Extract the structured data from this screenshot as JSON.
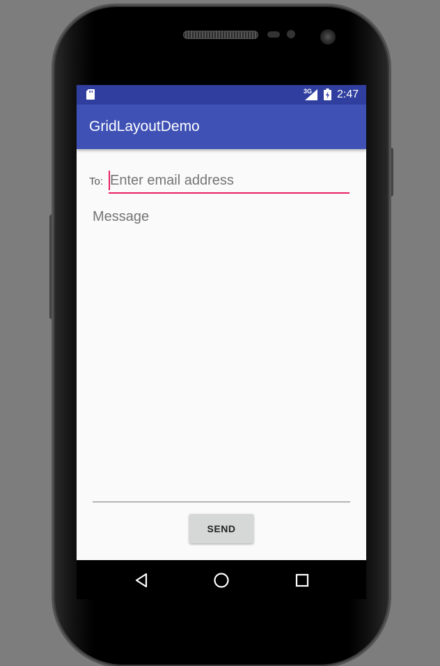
{
  "status_bar": {
    "network_type": "3G",
    "time": "2:47",
    "icons": [
      "sd-card-icon",
      "signal-icon",
      "battery-icon"
    ]
  },
  "app_bar": {
    "title": "GridLayoutDemo"
  },
  "form": {
    "to_label": "To:",
    "email_placeholder": "Enter email address",
    "email_value": "",
    "message_placeholder": "Message",
    "message_value": "",
    "send_label": "SEND"
  },
  "nav_bar": {
    "icons": [
      "back-icon",
      "home-icon",
      "recents-icon"
    ]
  },
  "colors": {
    "status_bar": "#303f9f",
    "app_bar": "#3f51b5",
    "accent": "#e91e63",
    "screen_bg": "#fafafa",
    "button_bg": "#d6d7d7"
  }
}
